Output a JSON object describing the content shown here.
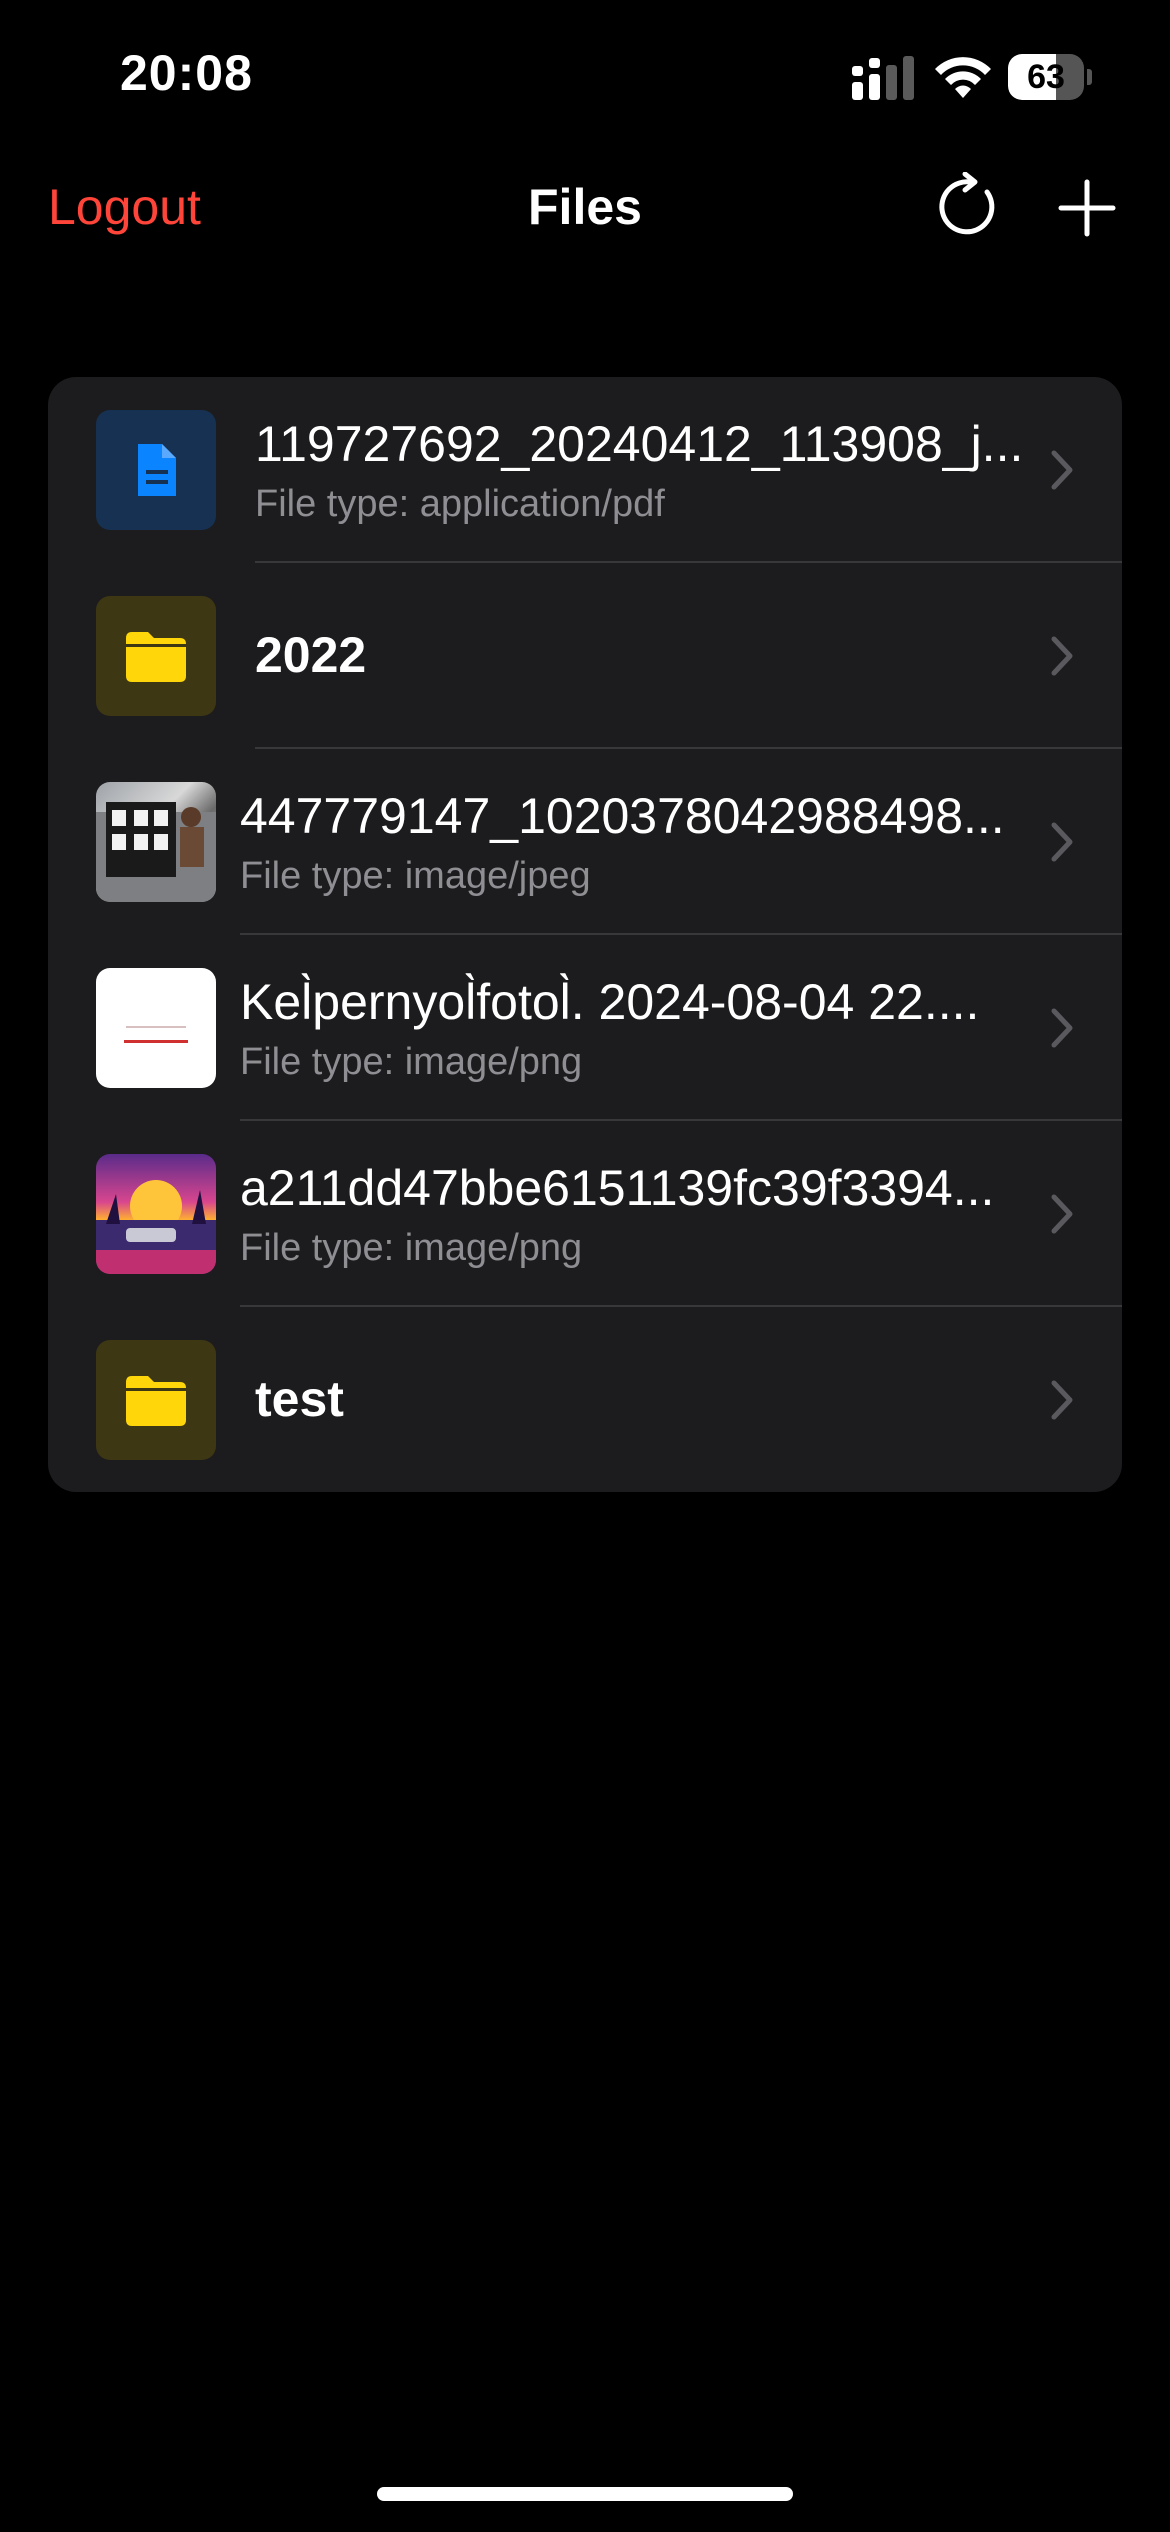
{
  "status_bar": {
    "time": "20:08",
    "battery_level": "63",
    "battery_fraction": 0.63
  },
  "nav": {
    "logout_label": "Logout",
    "title": "Files",
    "refresh_icon": "refresh-icon",
    "add_icon": "plus-icon"
  },
  "files": [
    {
      "name": "119727692_20240412_113908_j...",
      "subtitle": "File type: application/pdf",
      "kind": "pdf",
      "icon": "document-icon"
    },
    {
      "name": "2022",
      "subtitle": "",
      "kind": "folder",
      "icon": "folder-icon"
    },
    {
      "name": "447779147_1020378042988498...",
      "subtitle": "File type: image/jpeg",
      "kind": "image",
      "icon": "photo-thumbnail"
    },
    {
      "name": "Kel̀pernyol̀fotol̀. 2024-08-04 22....",
      "subtitle": "File type: image/png",
      "kind": "image",
      "icon": "screenshot-thumbnail"
    },
    {
      "name": "a211dd47bbe6151139fc39f3394...",
      "subtitle": "File type: image/png",
      "kind": "image",
      "icon": "sunset-thumbnail"
    },
    {
      "name": "test",
      "subtitle": "",
      "kind": "folder",
      "icon": "folder-icon"
    }
  ],
  "colors": {
    "accent_red": "#ff453a",
    "folder_yellow": "#ffd60a",
    "doc_blue": "#0a84ff",
    "card_bg": "#1c1c1e",
    "secondary_text": "#8e8e93"
  }
}
